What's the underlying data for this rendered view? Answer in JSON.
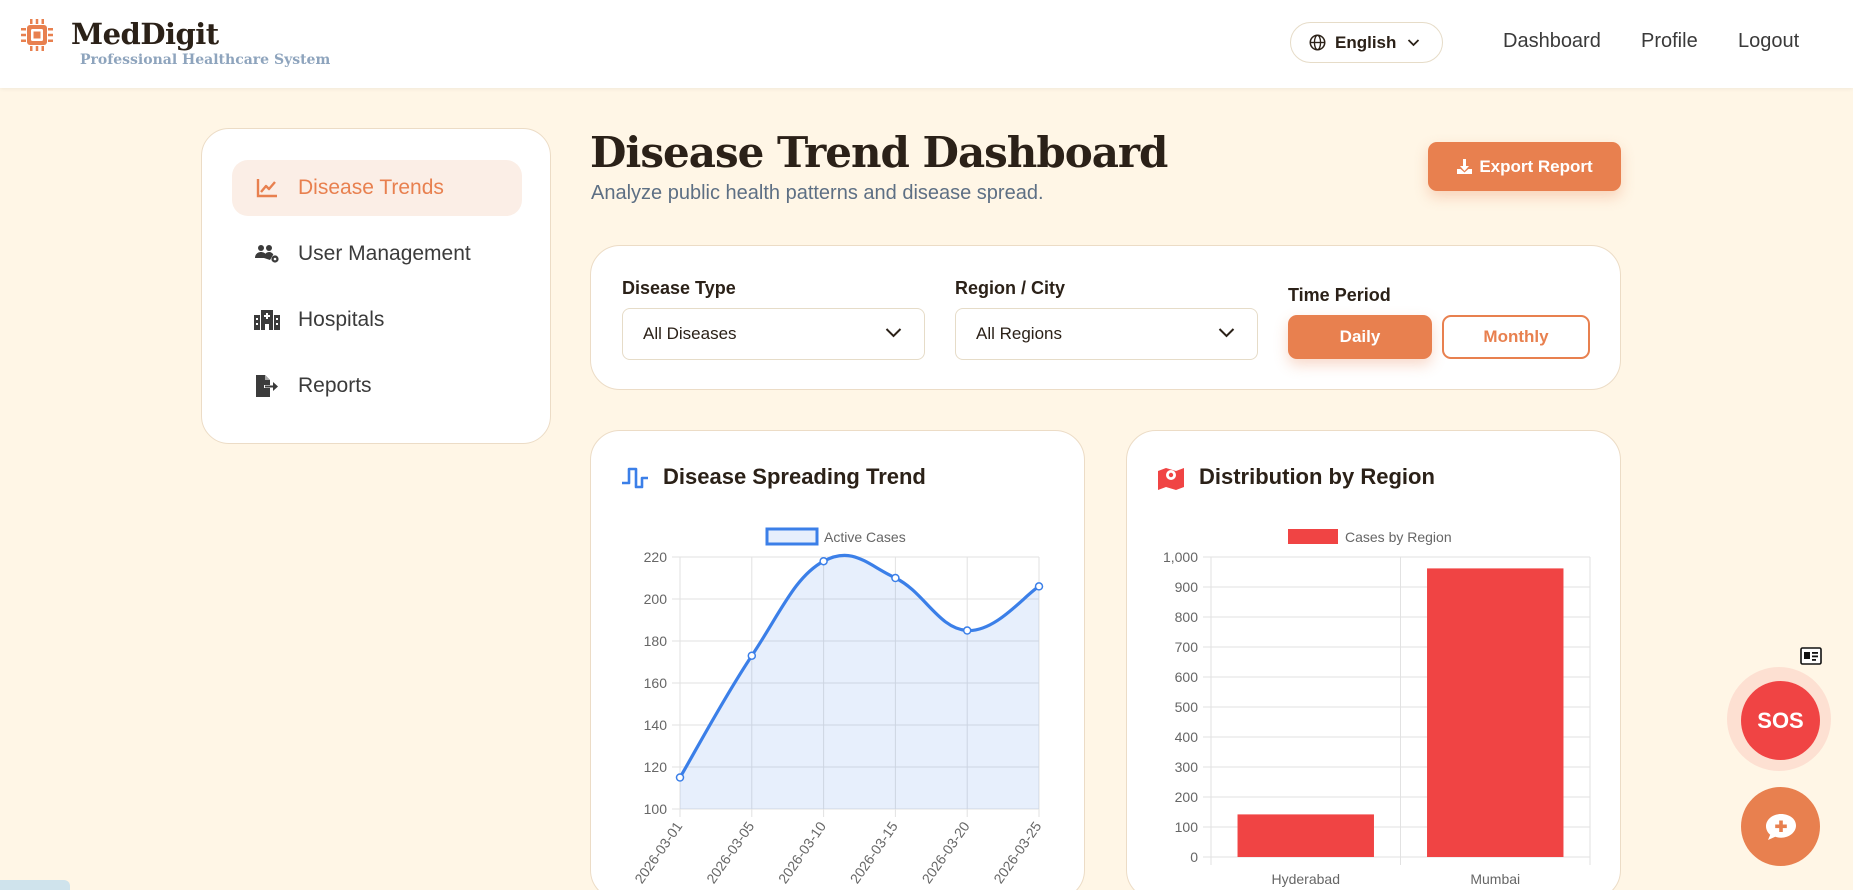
{
  "header": {
    "brand_name": "MedDigit",
    "brand_tagline": "Professional Healthcare System",
    "language": "English",
    "nav": [
      "Dashboard",
      "Profile",
      "Logout"
    ]
  },
  "sidebar": {
    "items": [
      {
        "label": "Disease Trends",
        "icon": "chart-line-icon",
        "active": true
      },
      {
        "label": "User Management",
        "icon": "users-gear-icon",
        "active": false
      },
      {
        "label": "Hospitals",
        "icon": "hospital-icon",
        "active": false
      },
      {
        "label": "Reports",
        "icon": "file-export-icon",
        "active": false
      }
    ]
  },
  "main": {
    "title": "Disease Trend Dashboard",
    "subtitle": "Analyze public health patterns and disease spread.",
    "export_label": "Export Report"
  },
  "filters": {
    "disease_label": "Disease Type",
    "disease_value": "All Diseases",
    "region_label": "Region / City",
    "region_value": "All Regions",
    "period_label": "Time Period",
    "period_daily": "Daily",
    "period_monthly": "Monthly",
    "period_selected": "Daily"
  },
  "cards": {
    "trend_title": "Disease Spreading Trend",
    "region_title": "Distribution by Region"
  },
  "floating": {
    "sos_label": "SOS"
  },
  "colors": {
    "accent": "#e8804f",
    "line_series": "#3b7fe8",
    "bar_series": "#f04444",
    "background": "#fff6e6"
  },
  "chart_data": [
    {
      "type": "line",
      "legend": "Active Cases",
      "x": [
        "2026-03-01",
        "2026-03-05",
        "2026-03-10",
        "2026-03-15",
        "2026-03-20",
        "2026-03-25"
      ],
      "series": [
        {
          "name": "Active Cases",
          "values": [
            115,
            173,
            218,
            210,
            185,
            206
          ]
        }
      ],
      "ylim": [
        100,
        220
      ],
      "yticks": [
        100,
        120,
        140,
        160,
        180,
        200,
        220
      ],
      "grid": true,
      "fill": true,
      "legend_position": "top"
    },
    {
      "type": "bar",
      "legend": "Cases by Region",
      "categories": [
        "Hyderabad",
        "Mumbai"
      ],
      "series": [
        {
          "name": "Cases by Region",
          "values": [
            142,
            962
          ]
        }
      ],
      "ylim": [
        0,
        1000
      ],
      "yticks": [
        "0",
        "100",
        "200",
        "300",
        "400",
        "500",
        "600",
        "700",
        "800",
        "900",
        "1,000"
      ],
      "grid": true,
      "legend_position": "top"
    }
  ]
}
